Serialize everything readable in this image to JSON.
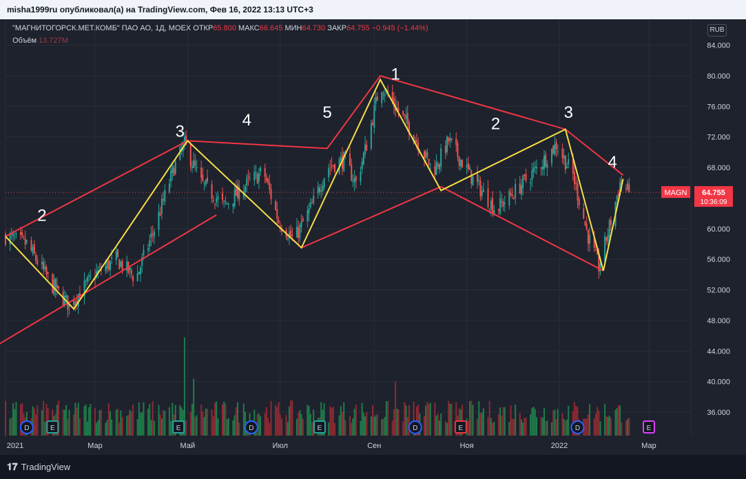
{
  "header": {
    "publisher": "misha1999ru опубликовал(а) на TradingView.com, Фев 16, 2022 13:13 UTC+3"
  },
  "legend": {
    "symbol": "\"МАГНИТОГОРСК.МЕТ.КОМБ\" ПАО АО, 1Д, MOEX",
    "open_label": "ОТКР",
    "open": "65.800",
    "high_label": "МАКС",
    "high": "66.645",
    "low_label": "МИН",
    "low": "64.730",
    "close_label": "ЗАКР",
    "close": "64.755",
    "change": "−0.945 (−1.44%)",
    "volume_label": "Объём",
    "volume": "13.727M"
  },
  "currency": "RUB",
  "price_tag": {
    "symbol": "MAGN",
    "price": "64.755",
    "timer": "10:36:09"
  },
  "footer": {
    "brand": "TradingView"
  },
  "colors": {
    "up": "#26a69a",
    "down": "#ef5350",
    "wave": "#f7e046",
    "channel": "#f23645",
    "background": "#1e222d"
  },
  "chart_data": {
    "type": "candlestick",
    "y_ticks": [
      "84.000",
      "80.000",
      "76.000",
      "72.000",
      "68.000",
      "64.000",
      "60.000",
      "56.000",
      "52.000",
      "48.000",
      "44.000",
      "40.000",
      "36.000"
    ],
    "ylim": [
      33.5,
      86
    ],
    "x_ticks": [
      {
        "label": "2021",
        "date": "2021-01-01"
      },
      {
        "label": "Мар",
        "date": "2021-03-01"
      },
      {
        "label": "Май",
        "date": "2021-05-01"
      },
      {
        "label": "Июл",
        "date": "2021-07-01"
      },
      {
        "label": "Сен",
        "date": "2021-09-01"
      },
      {
        "label": "Ноя",
        "date": "2021-11-01"
      },
      {
        "label": "2022",
        "date": "2022-01-01"
      },
      {
        "label": "Мар",
        "date": "2022-03-01"
      }
    ],
    "price_anchors": [
      {
        "date": "2021-01-01",
        "close": 59.0
      },
      {
        "date": "2021-01-15",
        "close": 58.0
      },
      {
        "date": "2021-02-01",
        "close": 52.5
      },
      {
        "date": "2021-02-12",
        "close": 50.0
      },
      {
        "date": "2021-03-01",
        "close": 54.0
      },
      {
        "date": "2021-03-15",
        "close": 56.0
      },
      {
        "date": "2021-03-28",
        "close": 53.5
      },
      {
        "date": "2021-04-10",
        "close": 60.5
      },
      {
        "date": "2021-04-22",
        "close": 68.0
      },
      {
        "date": "2021-04-29",
        "close": 71.0
      },
      {
        "date": "2021-05-10",
        "close": 66.0
      },
      {
        "date": "2021-05-25",
        "close": 63.0
      },
      {
        "date": "2021-06-10",
        "close": 66.0
      },
      {
        "date": "2021-06-20",
        "close": 67.5
      },
      {
        "date": "2021-06-30",
        "close": 61.0
      },
      {
        "date": "2021-07-10",
        "close": 58.5
      },
      {
        "date": "2021-07-22",
        "close": 63.0
      },
      {
        "date": "2021-08-01",
        "close": 68.0
      },
      {
        "date": "2021-08-12",
        "close": 69.0
      },
      {
        "date": "2021-08-20",
        "close": 66.0
      },
      {
        "date": "2021-08-27",
        "close": 71.0
      },
      {
        "date": "2021-09-05",
        "close": 79.0
      },
      {
        "date": "2021-09-15",
        "close": 76.0
      },
      {
        "date": "2021-09-25",
        "close": 73.0
      },
      {
        "date": "2021-10-10",
        "close": 67.5
      },
      {
        "date": "2021-10-20",
        "close": 71.5
      },
      {
        "date": "2021-11-05",
        "close": 66.5
      },
      {
        "date": "2021-11-20",
        "close": 62.5
      },
      {
        "date": "2021-12-01",
        "close": 64.5
      },
      {
        "date": "2021-12-20",
        "close": 68.5
      },
      {
        "date": "2021-12-30",
        "close": 71.0
      },
      {
        "date": "2022-01-10",
        "close": 67.0
      },
      {
        "date": "2022-01-20",
        "close": 59.0
      },
      {
        "date": "2022-01-27",
        "close": 55.0
      },
      {
        "date": "2022-02-04",
        "close": 61.0
      },
      {
        "date": "2022-02-10",
        "close": 66.0
      },
      {
        "date": "2022-02-16",
        "close": 64.755
      }
    ],
    "volume_spikes": [
      {
        "date": "2021-04-29",
        "level": 0.95
      },
      {
        "date": "2021-05-05",
        "level": 0.55
      },
      {
        "date": "2021-09-15",
        "level": 0.52
      },
      {
        "date": "2022-01-22",
        "level": 0.55
      }
    ],
    "wave_lines": {
      "yellow": [
        [
          {
            "date": "2021-01-01",
            "price": 59.0
          },
          {
            "date": "2021-02-15",
            "price": 49.5
          },
          {
            "date": "2021-05-01",
            "price": 71.5
          },
          {
            "date": "2021-07-15",
            "price": 57.5
          },
          {
            "date": "2021-09-05",
            "price": 79.5
          },
          {
            "date": "2021-10-15",
            "price": 65.0
          },
          {
            "date": "2022-01-05",
            "price": 73.0
          },
          {
            "date": "2022-01-30",
            "price": 54.5
          },
          {
            "date": "2022-02-12",
            "price": 66.5
          }
        ]
      ],
      "red": [
        [
          {
            "date": "2020-12-20",
            "price": 44.0
          },
          {
            "date": "2021-05-20",
            "price": 61.8
          }
        ],
        [
          {
            "date": "2021-01-01",
            "price": 59.0
          },
          {
            "date": "2021-05-01",
            "price": 71.5
          },
          {
            "date": "2021-08-01",
            "price": 70.5
          },
          {
            "date": "2021-09-05",
            "price": 80.0
          },
          {
            "date": "2022-01-05",
            "price": 73.0
          },
          {
            "date": "2022-02-12",
            "price": 67.0
          }
        ],
        [
          {
            "date": "2021-07-15",
            "price": 57.5
          },
          {
            "date": "2021-10-15",
            "price": 65.5
          }
        ],
        [
          {
            "date": "2021-10-15",
            "price": 65.5
          },
          {
            "date": "2022-01-30",
            "price": 54.5
          }
        ]
      ]
    },
    "wave_labels": [
      {
        "text": "2",
        "date": "2021-01-25",
        "price": 61.0
      },
      {
        "text": "3",
        "date": "2021-04-26",
        "price": 72.0
      },
      {
        "text": "4",
        "date": "2021-06-09",
        "price": 73.5
      },
      {
        "text": "5",
        "date": "2021-08-01",
        "price": 74.5
      },
      {
        "text": "1",
        "date": "2021-09-15",
        "price": 79.5
      },
      {
        "text": "2",
        "date": "2021-11-20",
        "price": 73.0
      },
      {
        "text": "3",
        "date": "2022-01-07",
        "price": 74.5
      },
      {
        "text": "4",
        "date": "2022-02-05",
        "price": 68.0
      }
    ],
    "event_markers": [
      {
        "kind": "D",
        "date": "2021-01-15"
      },
      {
        "kind": "E",
        "date": "2021-02-01"
      },
      {
        "kind": "E",
        "date": "2021-04-25"
      },
      {
        "kind": "D",
        "date": "2021-06-12"
      },
      {
        "kind": "E",
        "date": "2021-07-27"
      },
      {
        "kind": "D",
        "date": "2021-09-28"
      },
      {
        "kind": "E",
        "date": "2021-10-28"
      },
      {
        "kind": "D",
        "date": "2022-01-13"
      },
      {
        "kind": "E",
        "date": "2022-03-01"
      }
    ]
  }
}
